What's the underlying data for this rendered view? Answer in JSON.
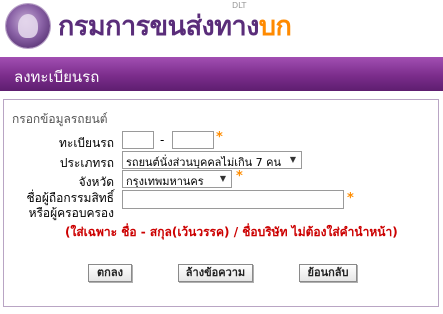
{
  "header": {
    "brand_prefix": "กรมการขนส่งทาง",
    "brand_accent": "บก",
    "brand_sub": "DLT"
  },
  "page_title": "ลงทะเบียนรถ",
  "section_title": "กรอกข้อมูลรถยนต์",
  "form": {
    "plate_label": "ทะเบียนรถ",
    "plate_dash": "-",
    "plate_part1": "",
    "plate_part2": "",
    "type_label": "ประเภทรถ",
    "type_value": "รถยนต์นั่งส่วนบุคคลไม่เกิน 7 คน",
    "province_label": "จังหวัด",
    "province_value": "กรุงเทพมหานคร",
    "owner_label_line1": "ชื่อผู้ถือกรรมสิทธิ์",
    "owner_label_line2": "หรือผู้ครอบครอง",
    "owner_value": "",
    "required_mark": "*"
  },
  "note": "(ใส่เฉพาะ ชื่อ - สกุล(เว้นวรรค) / ชื่อบริษัท ไม่ต้องใส่คำนำหน้า)",
  "buttons": {
    "submit": "ตกลง",
    "clear": "ล้างข้อความ",
    "back": "ย้อนกลับ"
  },
  "colors": {
    "title_bar": "#7b2d8c",
    "brand": "#5a2d7a",
    "brand_accent": "#ff8a00",
    "required": "#ff8c00",
    "note": "#cc0000"
  }
}
